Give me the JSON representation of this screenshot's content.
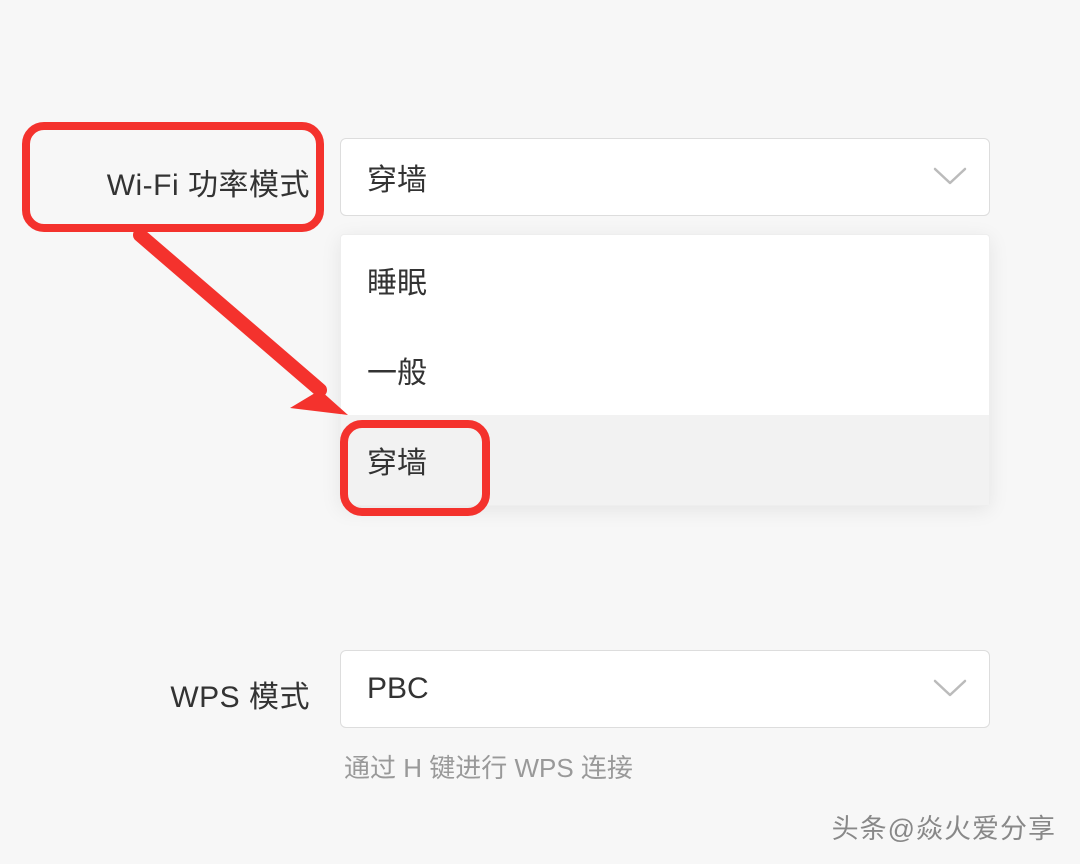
{
  "wifi_power": {
    "label": "Wi-Fi 功率模式",
    "selected": "穿墙",
    "options": [
      "睡眠",
      "一般",
      "穿墙"
    ],
    "selected_index": 2
  },
  "wps_mode": {
    "label": "WPS 模式",
    "selected": "PBC",
    "hint": "通过 H 键进行 WPS 连接"
  },
  "colors": {
    "highlight": "#f4322d",
    "background": "#f7f7f7",
    "text": "#333333",
    "muted": "#999999",
    "border": "#dddddd"
  },
  "watermark": "头条@焱火爱分享"
}
